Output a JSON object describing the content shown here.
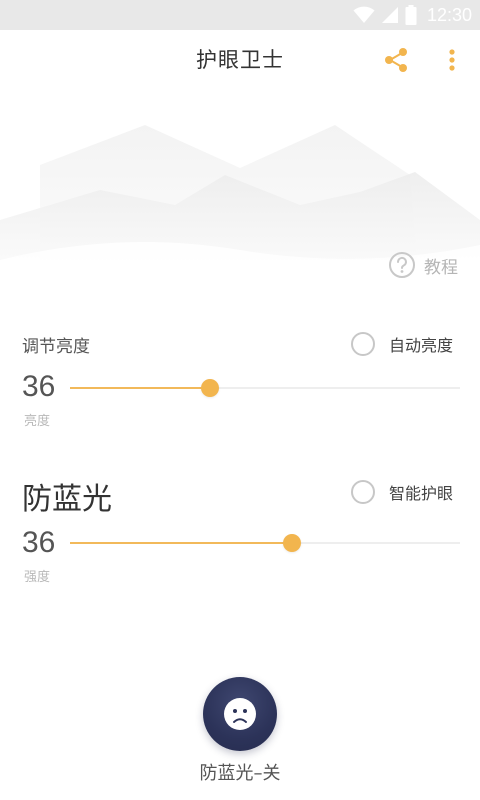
{
  "status_bar": {
    "time": "12:30",
    "icons": [
      "wifi-icon",
      "signal-icon",
      "battery-icon"
    ]
  },
  "app_bar": {
    "title": "护眼卫士",
    "share_icon": "share-icon",
    "more_icon": "more-vert-icon"
  },
  "colors": {
    "accent": "#F2B54E",
    "fab_bg": "#2C3359",
    "muted": "#B5B5B5"
  },
  "tutorial": {
    "label": "教程",
    "icon": "help-circle-icon"
  },
  "brightness": {
    "title": "调节亮度",
    "auto_label": "自动亮度",
    "auto_checked": false,
    "value": "36",
    "unit": "亮度",
    "level": 0.36
  },
  "blue_light": {
    "title": "防蓝光",
    "smart_label": "智能护眼",
    "smart_checked": false,
    "value": "36",
    "unit": "强度",
    "level": 0.57
  },
  "toggle": {
    "label": "防蓝光–关",
    "icon": "sad-face-icon",
    "state": "off"
  }
}
